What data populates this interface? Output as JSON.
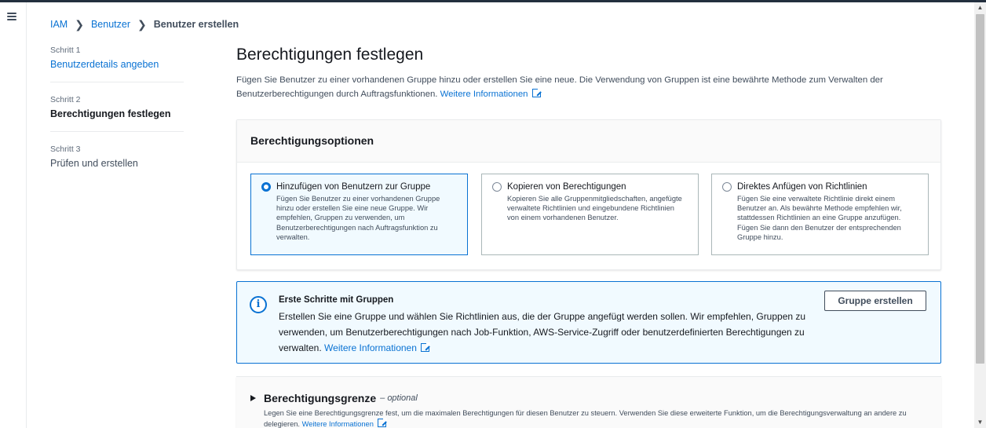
{
  "breadcrumb": [
    "IAM",
    "Benutzer",
    "Benutzer erstellen"
  ],
  "steps": [
    {
      "num": "Schritt 1",
      "label": "Benutzerdetails angeben"
    },
    {
      "num": "Schritt 2",
      "label": "Berechtigungen festlegen"
    },
    {
      "num": "Schritt 3",
      "label": "Prüfen und erstellen"
    }
  ],
  "page": {
    "title": "Berechtigungen festlegen",
    "description": "Fügen Sie Benutzer zu einer vorhandenen Gruppe hinzu oder erstellen Sie eine neue. Die Verwendung von Gruppen ist eine bewährte Methode zum Verwalten der Benutzerberechtigungen durch Auftragsfunktionen.",
    "learn_more": "Weitere Informationen"
  },
  "options": {
    "heading": "Berechtigungsoptionen",
    "tiles": [
      {
        "title": "Hinzufügen von Benutzern zur Gruppe",
        "body": "Fügen Sie Benutzer zu einer vorhandenen Gruppe hinzu oder erstellen Sie eine neue Gruppe. Wir empfehlen, Gruppen zu verwenden, um Benutzerberechtigungen nach Auftragsfunktion zu verwalten.",
        "selected": true
      },
      {
        "title": "Kopieren von Berechtigungen",
        "body": "Kopieren Sie alle Gruppenmitgliedschaften, angefügte verwaltete Richtlinien und eingebundene Richtlinien von einem vorhandenen Benutzer.",
        "selected": false
      },
      {
        "title": "Direktes Anfügen von Richtlinien",
        "body": "Fügen Sie eine verwaltete Richtlinie direkt einem Benutzer an. Als bewährte Methode empfehlen wir, stattdessen Richtlinien an eine Gruppe anzufügen. Fügen Sie dann den Benutzer der entsprechenden Gruppe hinzu.",
        "selected": false
      }
    ]
  },
  "info": {
    "title": "Erste Schritte mit Gruppen",
    "text": "Erstellen Sie eine Gruppe und wählen Sie Richtlinien aus, die der Gruppe angefügt werden sollen. Wir empfehlen, Gruppen zu verwenden, um Benutzerberechtigungen nach Job-Funktion, AWS-Service-Zugriff oder benutzerdefinierten Berechtigungen zu verwalten.",
    "learn_more": "Weitere Informationen",
    "button": "Gruppe erstellen"
  },
  "boundary": {
    "title": "Berechtigungsgrenze",
    "optional": "– optional",
    "text": "Legen Sie eine Berechtigungsgrenze fest, um die maximalen Berechtigungen für diesen Benutzer zu steuern. Verwenden Sie diese erweiterte Funktion, um die Berechtigungsverwaltung an andere zu delegieren.",
    "learn_more": "Weitere Informationen"
  },
  "colors": {
    "accent": "#0972d3",
    "selected_bg": "#f1faff"
  }
}
